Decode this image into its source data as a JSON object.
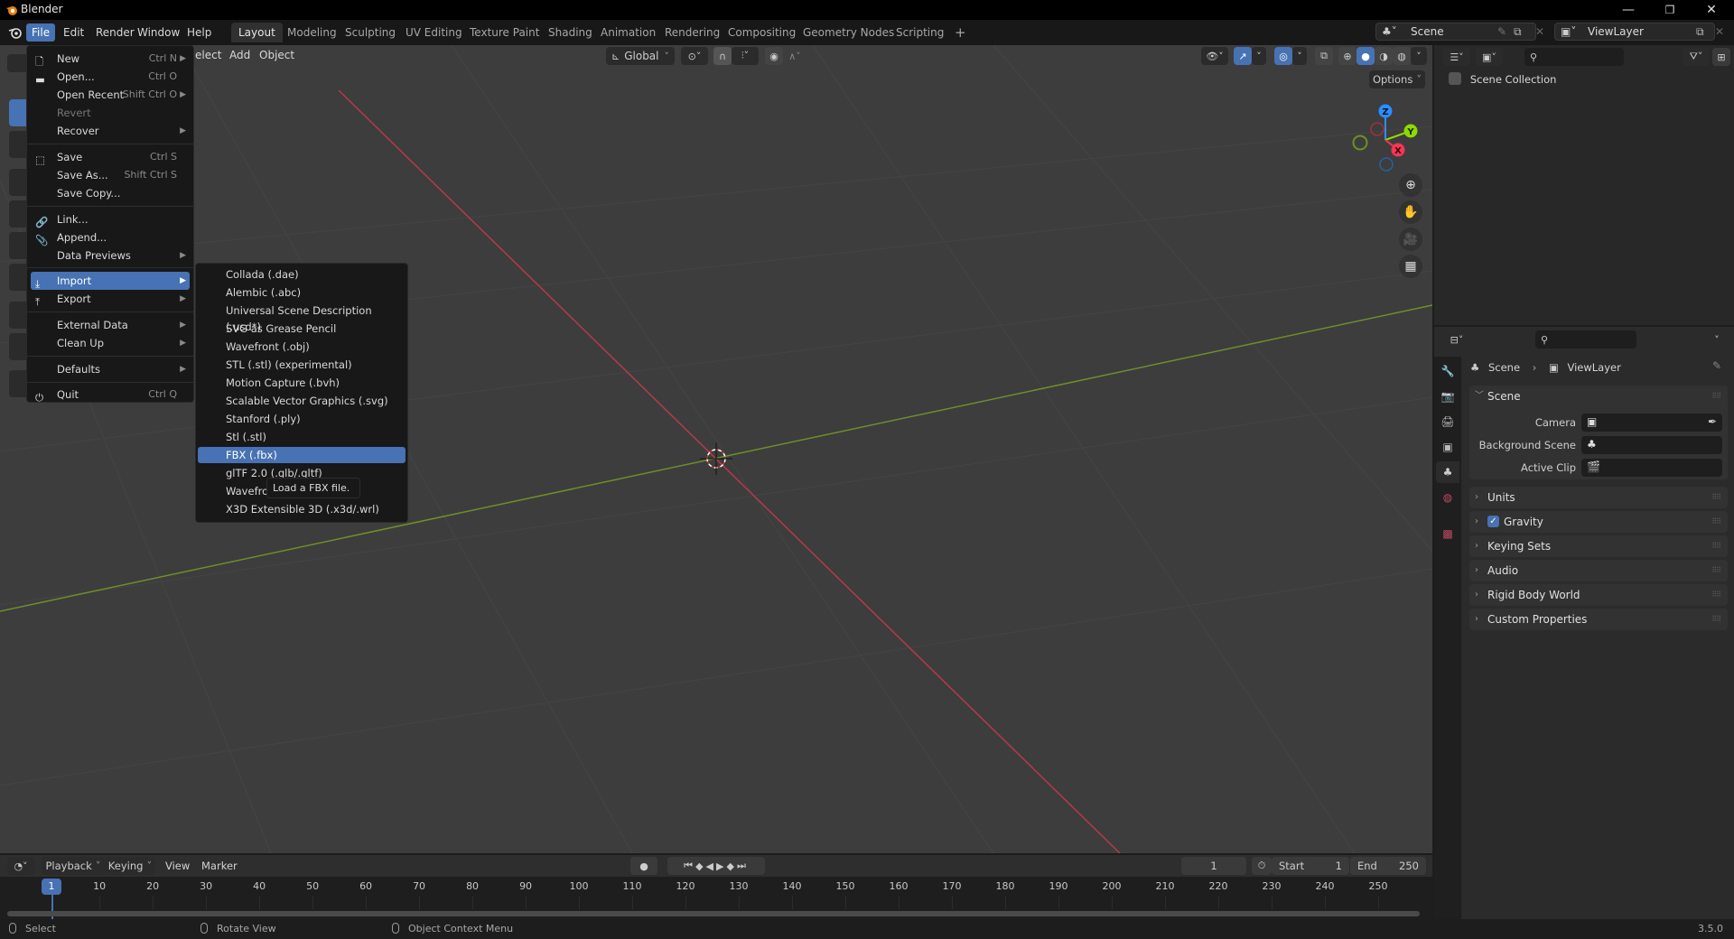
{
  "window": {
    "title": "Blender",
    "controls": [
      "minimize-icon",
      "restore-icon",
      "close-icon"
    ]
  },
  "topbar": {
    "menus": [
      "File",
      "Edit",
      "Render",
      "Window",
      "Help"
    ],
    "active_menu": "File",
    "workspaces": [
      "Layout",
      "Modeling",
      "Sculpting",
      "UV Editing",
      "Texture Paint",
      "Shading",
      "Animation",
      "Rendering",
      "Compositing",
      "Geometry Nodes",
      "Scripting"
    ],
    "active_workspace": "Layout",
    "add_workspace": "+",
    "scene": "Scene",
    "view_layer": "ViewLayer"
  },
  "viewport_header": {
    "menus": [
      "Select",
      "Add",
      "Object"
    ],
    "visible_menu_text": [
      "elect",
      "Add",
      "Object"
    ],
    "transform_orientation": "Global",
    "options_label": "Options"
  },
  "gizmo": {
    "axes": [
      "Z",
      "Y",
      "X"
    ],
    "colors": {
      "x": "#ff3352",
      "y": "#8bdc00",
      "z": "#2890ff"
    }
  },
  "file_menu": {
    "items": [
      {
        "label": "New",
        "shortcut": "Ctrl N",
        "submenu": true,
        "icon": "new-file-icon"
      },
      {
        "label": "Open...",
        "shortcut": "Ctrl O",
        "icon": "folder-icon"
      },
      {
        "label": "Open Recent",
        "shortcut": "Shift Ctrl O",
        "submenu": true
      },
      {
        "label": "Revert",
        "disabled": true
      },
      {
        "label": "Recover",
        "submenu": true
      },
      {
        "label": "Save",
        "shortcut": "Ctrl S",
        "icon": "save-icon"
      },
      {
        "label": "Save As...",
        "shortcut": "Shift Ctrl S"
      },
      {
        "label": "Save Copy..."
      },
      {
        "label": "Link...",
        "icon": "link-icon"
      },
      {
        "label": "Append...",
        "icon": "append-icon"
      },
      {
        "label": "Data Previews",
        "submenu": true
      },
      {
        "label": "Import",
        "submenu": true,
        "highlighted": true,
        "icon": "import-icon"
      },
      {
        "label": "Export",
        "submenu": true,
        "icon": "export-icon"
      },
      {
        "label": "External Data",
        "submenu": true
      },
      {
        "label": "Clean Up",
        "submenu": true
      },
      {
        "label": "Defaults",
        "submenu": true
      },
      {
        "label": "Quit",
        "shortcut": "Ctrl Q",
        "icon": "power-icon"
      }
    ]
  },
  "import_menu": {
    "items": [
      "Collada (.dae)",
      "Alembic (.abc)",
      "Universal Scene Description (.usd*)",
      "SVG as Grease Pencil",
      "Wavefront (.obj)",
      "STL (.stl) (experimental)",
      "Motion Capture (.bvh)",
      "Scalable Vector Graphics (.svg)",
      "Stanford (.ply)",
      "Stl (.stl)",
      "FBX (.fbx)",
      "glTF 2.0 (.glb/.gltf)",
      "Wavefront",
      "X3D Extensible 3D (.x3d/.wrl)"
    ],
    "highlighted": "FBX (.fbx)",
    "tooltip": "Load a FBX file."
  },
  "outliner": {
    "root": "Scene Collection"
  },
  "properties": {
    "breadcrumb": [
      "Scene",
      "ViewLayer"
    ],
    "scene_panel": {
      "title": "Scene",
      "fields": [
        {
          "label": "Camera",
          "value": ""
        },
        {
          "label": "Background Scene",
          "value": ""
        },
        {
          "label": "Active Clip",
          "value": ""
        }
      ]
    },
    "collapsed_panels": [
      {
        "title": "Units"
      },
      {
        "title": "Gravity",
        "checkbox": true,
        "checked": true
      },
      {
        "title": "Keying Sets"
      },
      {
        "title": "Audio"
      },
      {
        "title": "Rigid Body World"
      },
      {
        "title": "Custom Properties"
      }
    ]
  },
  "timeline": {
    "menus": [
      "Playback",
      "Keying",
      "View",
      "Marker"
    ],
    "current_frame": "1",
    "start_label": "Start",
    "start": "1",
    "end_label": "End",
    "end": "250",
    "ticks": [
      "1",
      "10",
      "20",
      "30",
      "40",
      "50",
      "60",
      "70",
      "80",
      "90",
      "100",
      "110",
      "120",
      "130",
      "140",
      "150",
      "160",
      "170",
      "180",
      "190",
      "200",
      "210",
      "220",
      "230",
      "240",
      "250"
    ]
  },
  "statusbar": {
    "hints": [
      "Select",
      "Rotate View",
      "Object Context Menu"
    ],
    "version": "3.5.0"
  }
}
